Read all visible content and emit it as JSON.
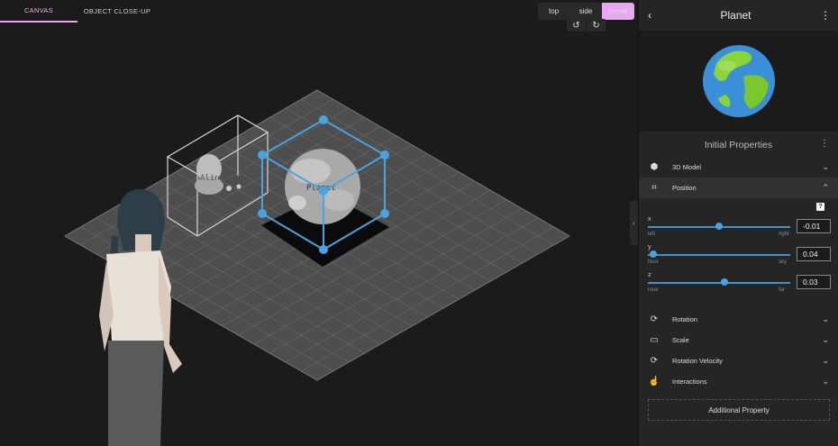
{
  "tabs": [
    {
      "label": "CANVAS",
      "active": true
    },
    {
      "label": "OBJECT CLOSE-UP",
      "active": false
    }
  ],
  "view_selector": {
    "top": "top",
    "side": "side",
    "corner": "corner",
    "selected": "corner"
  },
  "rotate": {
    "ccw": "↺",
    "cw": "↻"
  },
  "scene": {
    "objects": [
      {
        "label": "Aling",
        "selected": false
      },
      {
        "label": "Planet",
        "selected": true
      }
    ]
  },
  "panel": {
    "back_icon": "‹",
    "title": "Planet",
    "menu_icon": "⋮",
    "section_title": "Initial Properties",
    "section_menu_icon": "⋮",
    "rows": [
      {
        "key": "model",
        "icon": "model-3d-icon",
        "label": "3D Model"
      },
      {
        "key": "position",
        "icon": "crop-icon",
        "label": "Position",
        "open": true
      },
      {
        "key": "rotation",
        "icon": "rotate-3d-icon",
        "label": "Rotation"
      },
      {
        "key": "scale",
        "icon": "scale-icon",
        "label": "Scale"
      },
      {
        "key": "rotvel",
        "icon": "rotate-3d-icon",
        "label": "Rotation Velocity"
      },
      {
        "key": "interactions",
        "icon": "touch-icon",
        "label": "Interactions"
      }
    ],
    "help": "?",
    "axes": [
      {
        "name": "x",
        "low": "left",
        "high": "right",
        "value": "-0.01",
        "slider_fraction": 0.5
      },
      {
        "name": "y",
        "low": "floor",
        "high": "sky",
        "value": "0.04",
        "slider_fraction": 0.04
      },
      {
        "name": "z",
        "low": "near",
        "high": "far",
        "value": "0.03",
        "slider_fraction": 0.54
      }
    ],
    "add_property": "Additional Property"
  },
  "colors": {
    "accent": "#e9a6f2",
    "selection": "#4aa3e0"
  }
}
